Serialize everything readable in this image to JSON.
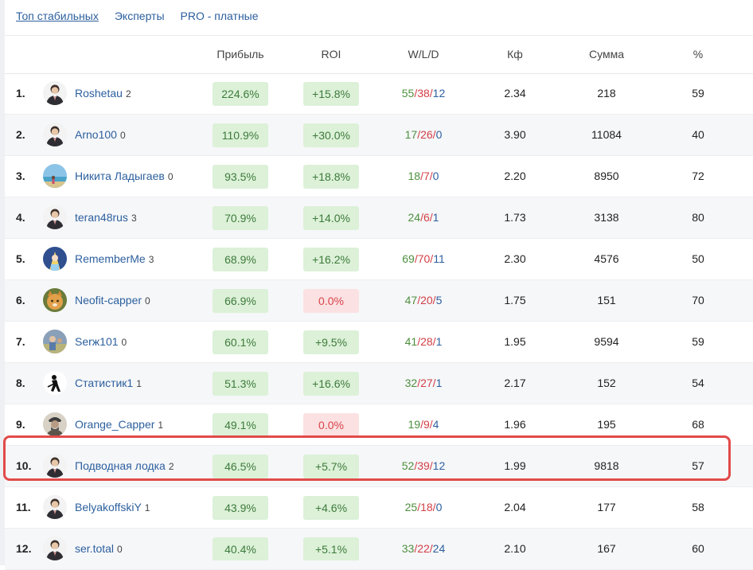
{
  "tabs": [
    {
      "label": "Топ стабильных",
      "active": true
    },
    {
      "label": "Эксперты",
      "active": false
    },
    {
      "label": "PRO - платные",
      "active": false
    }
  ],
  "columns": {
    "profit": "Прибыль",
    "roi": "ROI",
    "wld": "W/L/D",
    "kf": "Кф",
    "sum": "Сумма",
    "pct": "%"
  },
  "colors": {
    "link": "#2c5f9e",
    "green_pill": "#dcf1d8",
    "red_pill": "#fbe1e2",
    "win": "#4d8f3e",
    "loss": "#d23f46",
    "highlight": "#e24a4a"
  },
  "rows": [
    {
      "rank": "1.",
      "name": "Roshetau",
      "count": "2",
      "profit": "224.6%",
      "roi": "+15.8%",
      "roi_color": "green",
      "w": "55",
      "l": "38",
      "d": "12",
      "kf": "2.34",
      "sum": "218",
      "pct": "59",
      "avatar": "person-avatar-icon"
    },
    {
      "rank": "2.",
      "name": "Arno100",
      "count": "0",
      "profit": "110.9%",
      "roi": "+30.0%",
      "roi_color": "green",
      "w": "17",
      "l": "26",
      "d": "0",
      "kf": "3.90",
      "sum": "11084",
      "pct": "40",
      "avatar": "person-avatar-icon"
    },
    {
      "rank": "3.",
      "name": "Никита Ладыгаев",
      "count": "0",
      "profit": "93.5%",
      "roi": "+18.8%",
      "roi_color": "green",
      "w": "18",
      "l": "7",
      "d": "0",
      "kf": "2.20",
      "sum": "8950",
      "pct": "72",
      "avatar": "beach-photo-avatar-icon"
    },
    {
      "rank": "4.",
      "name": "teran48rus",
      "count": "3",
      "profit": "70.9%",
      "roi": "+14.0%",
      "roi_color": "green",
      "w": "24",
      "l": "6",
      "d": "1",
      "kf": "1.73",
      "sum": "3138",
      "pct": "80",
      "avatar": "person-avatar-icon"
    },
    {
      "rank": "5.",
      "name": "RememberMe",
      "count": "3",
      "profit": "68.9%",
      "roi": "+16.2%",
      "roi_color": "green",
      "w": "69",
      "l": "70",
      "d": "11",
      "kf": "2.30",
      "sum": "4576",
      "pct": "50",
      "avatar": "anime-avatar-icon"
    },
    {
      "rank": "6.",
      "name": "Neofit-capper",
      "count": "0",
      "profit": "66.9%",
      "roi": "0.0%",
      "roi_color": "red",
      "w": "47",
      "l": "20",
      "d": "5",
      "kf": "1.75",
      "sum": "151",
      "pct": "70",
      "avatar": "cat-avatar-icon"
    },
    {
      "rank": "7.",
      "name": "Serж101",
      "count": "0",
      "profit": "60.1%",
      "roi": "+9.5%",
      "roi_color": "green",
      "w": "41",
      "l": "28",
      "d": "1",
      "kf": "1.95",
      "sum": "9594",
      "pct": "59",
      "avatar": "photo-avatar-icon"
    },
    {
      "rank": "8.",
      "name": "Статистик1",
      "count": "1",
      "profit": "51.3%",
      "roi": "+16.6%",
      "roi_color": "green",
      "w": "32",
      "l": "27",
      "d": "1",
      "kf": "2.17",
      "sum": "152",
      "pct": "54",
      "avatar": "hockey-player-avatar-icon"
    },
    {
      "rank": "9.",
      "name": "Orange_Capper",
      "count": "1",
      "profit": "49.1%",
      "roi": "0.0%",
      "roi_color": "red",
      "w": "19",
      "l": "9",
      "d": "4",
      "kf": "1.96",
      "sum": "195",
      "pct": "68",
      "avatar": "portrait-avatar-icon"
    },
    {
      "rank": "10.",
      "name": "Подводная лодка",
      "count": "2",
      "profit": "46.5%",
      "roi": "+5.7%",
      "roi_color": "green",
      "w": "52",
      "l": "39",
      "d": "12",
      "kf": "1.99",
      "sum": "9818",
      "pct": "57",
      "avatar": "person-avatar-icon",
      "highlighted": true
    },
    {
      "rank": "11.",
      "name": "BelyakoffskiY",
      "count": "1",
      "profit": "43.9%",
      "roi": "+4.6%",
      "roi_color": "green",
      "w": "25",
      "l": "18",
      "d": "0",
      "kf": "2.04",
      "sum": "177",
      "pct": "58",
      "avatar": "person-avatar-icon"
    },
    {
      "rank": "12.",
      "name": "ser.total",
      "count": "0",
      "profit": "40.4%",
      "roi": "+5.1%",
      "roi_color": "green",
      "w": "33",
      "l": "22",
      "d": "24",
      "kf": "2.10",
      "sum": "167",
      "pct": "60",
      "avatar": "person-avatar-icon"
    }
  ]
}
